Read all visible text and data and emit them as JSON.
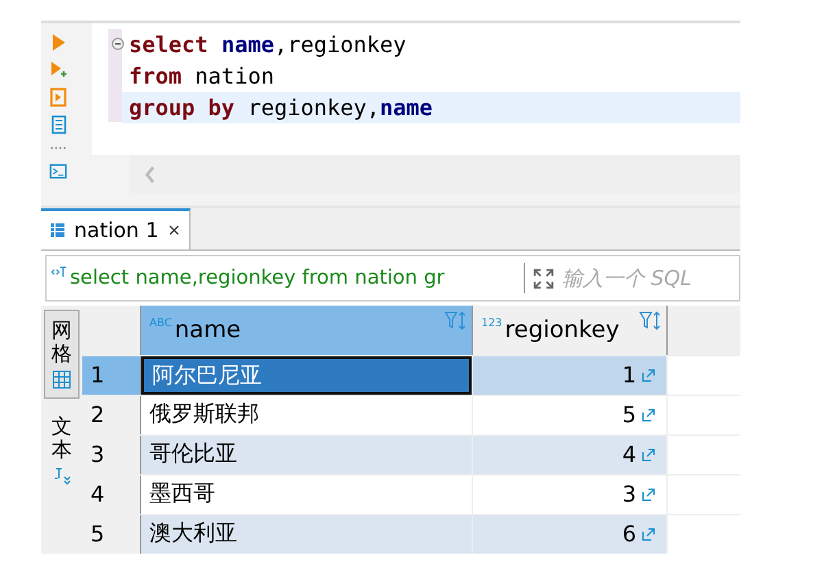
{
  "editor": {
    "lines": [
      {
        "current": false,
        "tokens": [
          {
            "text": "select ",
            "kind": "keyword"
          },
          {
            "text": "name",
            "kind": "column"
          },
          {
            "text": ",regionkey",
            "kind": "plain"
          }
        ]
      },
      {
        "current": false,
        "tokens": [
          {
            "text": "from",
            "kind": "keyword"
          },
          {
            "text": " nation",
            "kind": "plain"
          }
        ]
      },
      {
        "current": true,
        "tokens": [
          {
            "text": "group by",
            "kind": "keyword"
          },
          {
            "text": " regionkey,",
            "kind": "plain"
          },
          {
            "text": "name",
            "kind": "column"
          }
        ]
      }
    ]
  },
  "result_tabs": [
    {
      "label": "nation 1",
      "selected": true
    }
  ],
  "filter": {
    "value": "select name,regionkey from nation gr",
    "placeholder": "输入一个 SQL"
  },
  "view_tabs": [
    {
      "label": "网格",
      "selected": true
    },
    {
      "label": "文本",
      "selected": false
    }
  ],
  "table": {
    "columns": [
      {
        "label": "name",
        "type_badge": "ABC"
      },
      {
        "label": "regionkey",
        "type_badge": "123"
      }
    ],
    "rows": [
      {
        "index": "1",
        "name": "阿尔巴尼亚",
        "regionkey": "1",
        "selected": true
      },
      {
        "index": "2",
        "name": "俄罗斯联邦",
        "regionkey": "5",
        "selected": false
      },
      {
        "index": "3",
        "name": "哥伦比亚",
        "regionkey": "4",
        "selected": false
      },
      {
        "index": "4",
        "name": "墨西哥",
        "regionkey": "3",
        "selected": false
      },
      {
        "index": "5",
        "name": "澳大利亚",
        "regionkey": "6",
        "selected": false
      }
    ]
  }
}
